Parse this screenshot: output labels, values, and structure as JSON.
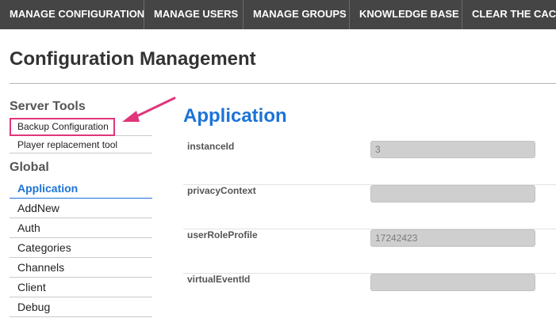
{
  "topnav": {
    "tabs": [
      {
        "label": "MANAGE CONFIGURATION"
      },
      {
        "label": "MANAGE USERS"
      },
      {
        "label": "MANAGE GROUPS"
      },
      {
        "label": "KNOWLEDGE BASE"
      },
      {
        "label": "CLEAR THE CACHE"
      }
    ]
  },
  "page": {
    "title": "Configuration Management"
  },
  "sidebar": {
    "server_tools": {
      "heading": "Server Tools",
      "items": [
        {
          "label": "Backup Configuration"
        },
        {
          "label": "Player replacement tool"
        }
      ]
    },
    "global": {
      "heading": "Global",
      "items": [
        {
          "label": "Application",
          "active": true
        },
        {
          "label": "AddNew"
        },
        {
          "label": "Auth"
        },
        {
          "label": "Categories"
        },
        {
          "label": "Channels"
        },
        {
          "label": "Client"
        },
        {
          "label": "Debug"
        }
      ]
    }
  },
  "main": {
    "section_title": "Application",
    "fields": [
      {
        "label": "instanceId",
        "value": "3"
      },
      {
        "label": "privacyContext",
        "value": ""
      },
      {
        "label": "userRoleProfile",
        "value": "17242423"
      },
      {
        "label": "virtualEventId",
        "value": ""
      }
    ]
  },
  "colors": {
    "nav_bg": "#454545",
    "accent_blue": "#1b73d8",
    "highlight_pink": "#e0357b",
    "input_bg": "#cfcfcf"
  },
  "icons": {
    "annotation": "arrow-icon"
  }
}
